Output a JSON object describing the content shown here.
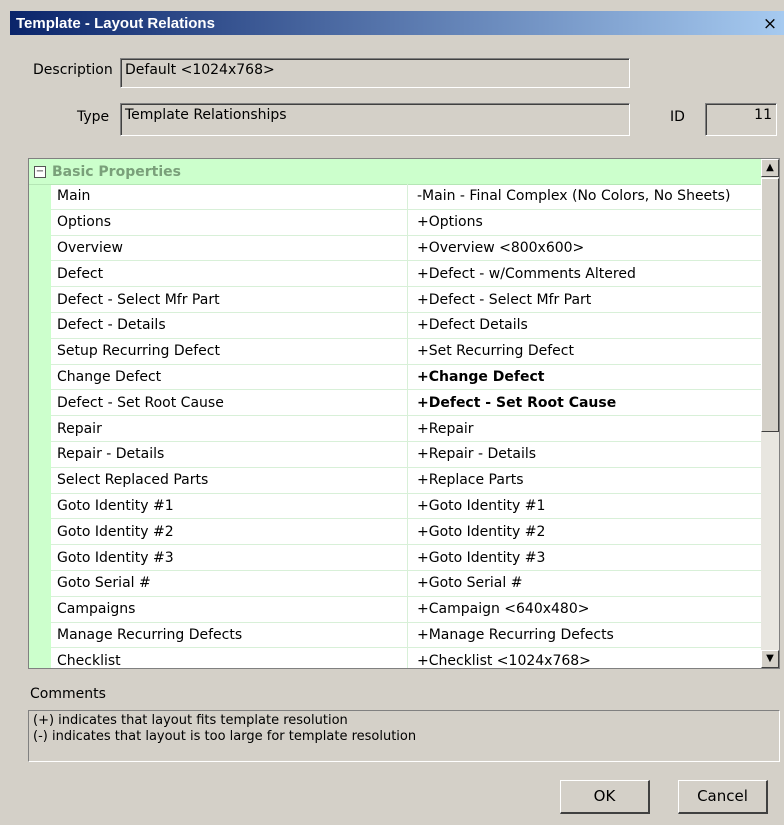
{
  "window": {
    "title": "Template - Layout Relations",
    "close_glyph": "×"
  },
  "form": {
    "description_label": "Description",
    "description_value": "Default <1024x768>",
    "type_label": "Type",
    "type_value": "Template Relationships",
    "id_label": "ID",
    "id_value": "11"
  },
  "grid": {
    "category": {
      "toggle": "⊟",
      "label": "Basic Properties"
    },
    "rows": [
      {
        "key": "Main",
        "value": "-Main - Final Complex (No Colors, No Sheets)",
        "bold": false
      },
      {
        "key": "Options",
        "value": "+Options",
        "bold": false
      },
      {
        "key": "Overview",
        "value": "+Overview <800x600>",
        "bold": false
      },
      {
        "key": "Defect",
        "value": "+Defect - w/Comments Altered",
        "bold": false
      },
      {
        "key": "Defect - Select Mfr Part",
        "value": "+Defect - Select Mfr Part",
        "bold": false
      },
      {
        "key": "Defect - Details",
        "value": "+Defect Details",
        "bold": false
      },
      {
        "key": "Setup Recurring Defect",
        "value": "+Set Recurring Defect",
        "bold": false
      },
      {
        "key": "Change Defect",
        "value": "+Change Defect",
        "bold": true
      },
      {
        "key": "Defect - Set Root Cause",
        "value": "+Defect - Set Root Cause",
        "bold": true
      },
      {
        "key": "Repair",
        "value": "+Repair",
        "bold": false
      },
      {
        "key": "Repair - Details",
        "value": "+Repair - Details",
        "bold": false
      },
      {
        "key": "Select Replaced Parts",
        "value": "+Replace Parts",
        "bold": false
      },
      {
        "key": "Goto Identity #1",
        "value": "+Goto Identity #1",
        "bold": false
      },
      {
        "key": "Goto Identity #2",
        "value": "+Goto Identity #2",
        "bold": false
      },
      {
        "key": "Goto Identity #3",
        "value": "+Goto Identity #3",
        "bold": false
      },
      {
        "key": "Goto Serial #",
        "value": "+Goto Serial #",
        "bold": false
      },
      {
        "key": "Campaigns",
        "value": "+Campaign <640x480>",
        "bold": false
      },
      {
        "key": "Manage Recurring Defects",
        "value": "+Manage Recurring Defects",
        "bold": false
      },
      {
        "key": "Checklist",
        "value": "+Checklist <1024x768>",
        "bold": false
      }
    ],
    "scroll_up_glyph": "▲",
    "scroll_down_glyph": "▼"
  },
  "comments": {
    "label": "Comments",
    "line1": "(+) indicates that layout fits template resolution",
    "line2": "(-) indicates that layout is too large for template resolution"
  },
  "buttons": {
    "ok": "OK",
    "cancel": "Cancel"
  },
  "colors": {
    "title_start": "#0a246a",
    "title_end": "#a6caf0",
    "category_bg": "#ccffcc",
    "category_text": "#7aa07a",
    "dialog_bg": "#d4d0c8"
  }
}
